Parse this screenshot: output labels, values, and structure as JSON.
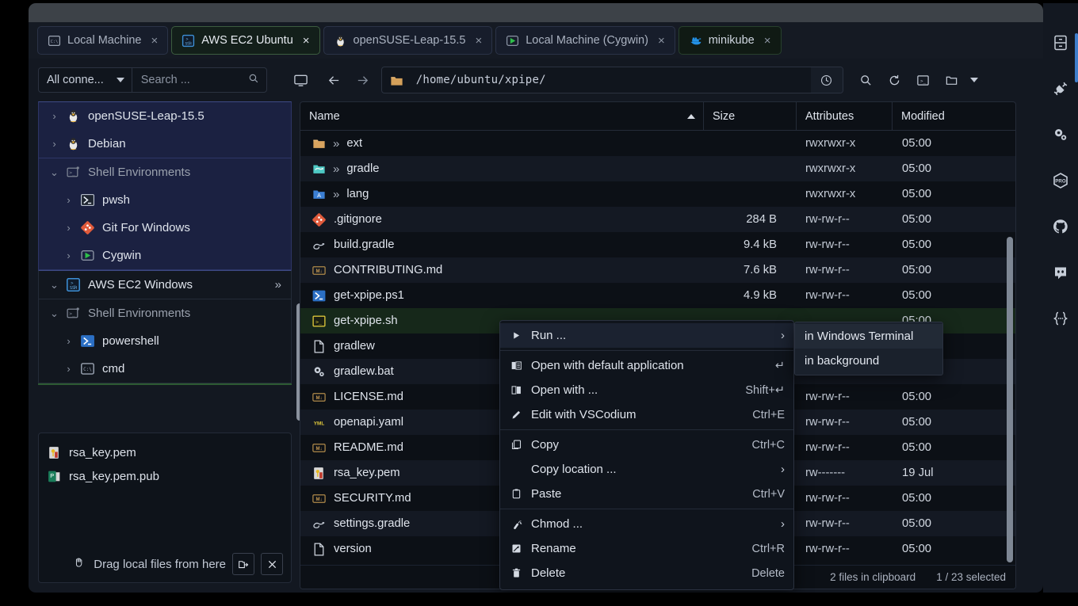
{
  "window": {
    "title": ""
  },
  "tabs": [
    {
      "label": "Local Machine",
      "icon": "cmd-icon",
      "close": "×",
      "state": "inactive"
    },
    {
      "label": "AWS EC2 Ubuntu",
      "icon": "ssh-icon",
      "close": "×",
      "state": "active"
    },
    {
      "label": "openSUSE-Leap-15.5",
      "icon": "linux-penguin-icon",
      "close": "×",
      "state": "inactive"
    },
    {
      "label": "Local Machine (Cygwin)",
      "icon": "cygwin-icon",
      "close": "×",
      "state": "inactive"
    },
    {
      "label": "minikube",
      "icon": "docker-whale-icon",
      "close": "×",
      "state": "green"
    }
  ],
  "toolbar": {
    "connection_filter": "All conne...",
    "search_placeholder": "Search ...",
    "search_value": "",
    "path": "/home/ubuntu/xpipe/",
    "monitor_title": "Local Machine",
    "back_label": "Back",
    "forward_label": "Forward"
  },
  "sidebar": {
    "groups": [
      {
        "style": "blue",
        "items": [
          {
            "label": "openSUSE-Leap-15.5",
            "icon": "linux-penguin-icon",
            "indent": 1,
            "chevron": "›"
          },
          {
            "label": "Debian",
            "icon": "linux-penguin-icon",
            "indent": 1,
            "chevron": "›"
          }
        ]
      },
      {
        "style": "blue",
        "items": [
          {
            "label": "Shell Environments",
            "icon": "terminal-box-icon",
            "indent": 1,
            "chevron": "⌄",
            "header": true
          },
          {
            "label": "pwsh",
            "icon": "powershell-icon",
            "indent": 2,
            "chevron": "›"
          },
          {
            "label": "Git For Windows",
            "icon": "git-icon",
            "indent": 2,
            "chevron": "›"
          },
          {
            "label": "Cygwin",
            "icon": "cygwin-icon",
            "indent": 2,
            "chevron": "›"
          }
        ]
      },
      {
        "style": "dark",
        "items": [
          {
            "label": "AWS EC2 Windows",
            "icon": "ssh-icon",
            "indent": 1,
            "chevron": "⌄",
            "more": "»"
          }
        ]
      },
      {
        "style": "dark",
        "items": [
          {
            "label": "Shell Environments",
            "icon": "terminal-box-icon",
            "indent": 1,
            "chevron": "⌄",
            "header": true
          },
          {
            "label": "powershell",
            "icon": "powershell-icon",
            "indent": 2,
            "chevron": "›"
          },
          {
            "label": "cmd",
            "icon": "cmd-icon",
            "indent": 2,
            "chevron": "›"
          }
        ]
      }
    ],
    "dropzone": {
      "files": [
        {
          "name": "rsa_key.pem",
          "icon": "key-file-icon"
        },
        {
          "name": "rsa_key.pem.pub",
          "icon": "pub-file-icon"
        }
      ],
      "hint": "Drag local files from here",
      "hand_icon": "hand-icon",
      "open_button": "open-folder-icon",
      "close_button": "close-icon"
    }
  },
  "browser": {
    "columns": {
      "name": "Name",
      "size": "Size",
      "attributes": "Attributes",
      "modified": "Modified"
    },
    "sort": "asc",
    "files": [
      {
        "name": "ext",
        "icon": "folder-icon",
        "expand": "»",
        "size": "",
        "attr": "rwxrwxr-x",
        "mod": "05:00"
      },
      {
        "name": "gradle",
        "icon": "gradle-folder-icon",
        "expand": "»",
        "size": "",
        "attr": "rwxrwxr-x",
        "mod": "05:00"
      },
      {
        "name": "lang",
        "icon": "lang-folder-icon",
        "expand": "»",
        "size": "",
        "attr": "rwxrwxr-x",
        "mod": "05:00"
      },
      {
        "name": ".gitignore",
        "icon": "git-icon",
        "expand": "",
        "size": "284 B",
        "attr": "rw-rw-r--",
        "mod": "05:00"
      },
      {
        "name": "build.gradle",
        "icon": "gradle-icon",
        "expand": "",
        "size": "9.4 kB",
        "attr": "rw-rw-r--",
        "mod": "05:00"
      },
      {
        "name": "CONTRIBUTING.md",
        "icon": "markdown-icon",
        "expand": "",
        "size": "7.6 kB",
        "attr": "rw-rw-r--",
        "mod": "05:00"
      },
      {
        "name": "get-xpipe.ps1",
        "icon": "powershell-icon",
        "expand": "",
        "size": "4.9 kB",
        "attr": "rw-rw-r--",
        "mod": "05:00"
      },
      {
        "name": "get-xpipe.sh",
        "icon": "shell-script-icon",
        "expand": "",
        "size": "",
        "attr": "",
        "mod": "05:00",
        "selected": true
      },
      {
        "name": "gradlew",
        "icon": "plain-file-icon",
        "expand": "",
        "size": "",
        "attr": "",
        "mod": ""
      },
      {
        "name": "gradlew.bat",
        "icon": "gears-icon",
        "expand": "",
        "size": "",
        "attr": "",
        "mod": ""
      },
      {
        "name": "LICENSE.md",
        "icon": "markdown-icon",
        "expand": "",
        "size": "",
        "attr": "rw-rw-r--",
        "mod": "05:00"
      },
      {
        "name": "openapi.yaml",
        "icon": "yaml-icon",
        "expand": "",
        "size": "",
        "attr": "rw-rw-r--",
        "mod": "05:00"
      },
      {
        "name": "README.md",
        "icon": "markdown-icon",
        "expand": "",
        "size": "",
        "attr": "rw-rw-r--",
        "mod": "05:00"
      },
      {
        "name": "rsa_key.pem",
        "icon": "key-file-icon",
        "expand": "",
        "size": "",
        "attr": "rw-------",
        "mod": "19 Jul"
      },
      {
        "name": "SECURITY.md",
        "icon": "markdown-icon",
        "expand": "",
        "size": "",
        "attr": "rw-rw-r--",
        "mod": "05:00"
      },
      {
        "name": "settings.gradle",
        "icon": "gradle-icon",
        "expand": "",
        "size": "",
        "attr": "rw-rw-r--",
        "mod": "05:00"
      },
      {
        "name": "version",
        "icon": "plain-file-icon",
        "expand": "",
        "size": "",
        "attr": "rw-rw-r--",
        "mod": "05:00"
      }
    ],
    "status": {
      "clipboard": "2 files in clipboard",
      "selection": "1 / 23 selected"
    }
  },
  "context_menu": {
    "items": [
      {
        "label": "Run ...",
        "icon": "play-icon",
        "accel": "",
        "arrow": "›",
        "highlighted": true
      },
      {
        "separator": true
      },
      {
        "label": "Open with default application",
        "icon": "book-open-icon",
        "accel": "↵"
      },
      {
        "label": "Open with ...",
        "icon": "book-icon",
        "accel": "Shift+↵"
      },
      {
        "label": "Edit with VSCodium",
        "icon": "pencil-icon",
        "accel": "Ctrl+E"
      },
      {
        "separator": true
      },
      {
        "label": "Copy",
        "icon": "copy-icon",
        "accel": "Ctrl+C"
      },
      {
        "label": "Copy location ...",
        "icon": "",
        "accel": "",
        "arrow": "›"
      },
      {
        "label": "Paste",
        "icon": "clipboard-icon",
        "accel": "Ctrl+V"
      },
      {
        "separator": true
      },
      {
        "label": "Chmod ...",
        "icon": "wrench-icon",
        "accel": "",
        "arrow": "›"
      },
      {
        "label": "Rename",
        "icon": "rename-icon",
        "accel": "Ctrl+R"
      },
      {
        "label": "Delete",
        "icon": "trash-icon",
        "accel": "Delete"
      }
    ]
  },
  "submenu": {
    "items": [
      {
        "label": "in Windows Terminal",
        "highlighted": true
      },
      {
        "label": "in background",
        "highlighted": false
      }
    ]
  },
  "rail": {
    "items": [
      {
        "name": "storage-icon",
        "label": "Connections"
      },
      {
        "name": "plug-icon",
        "label": "Connection hub"
      },
      {
        "name": "gears-icon",
        "label": "Settings"
      },
      {
        "name": "pro-badge-icon",
        "label": "PRO"
      },
      {
        "name": "github-icon",
        "label": "GitHub"
      },
      {
        "name": "discord-icon",
        "label": "Discord"
      },
      {
        "name": "braces-icon",
        "label": "API"
      }
    ]
  },
  "colors": {
    "accent_green": "#2d5a33",
    "selected_row": "#16281a",
    "scroll_blue": "#3f7ecb",
    "window_bg": "#131821"
  }
}
